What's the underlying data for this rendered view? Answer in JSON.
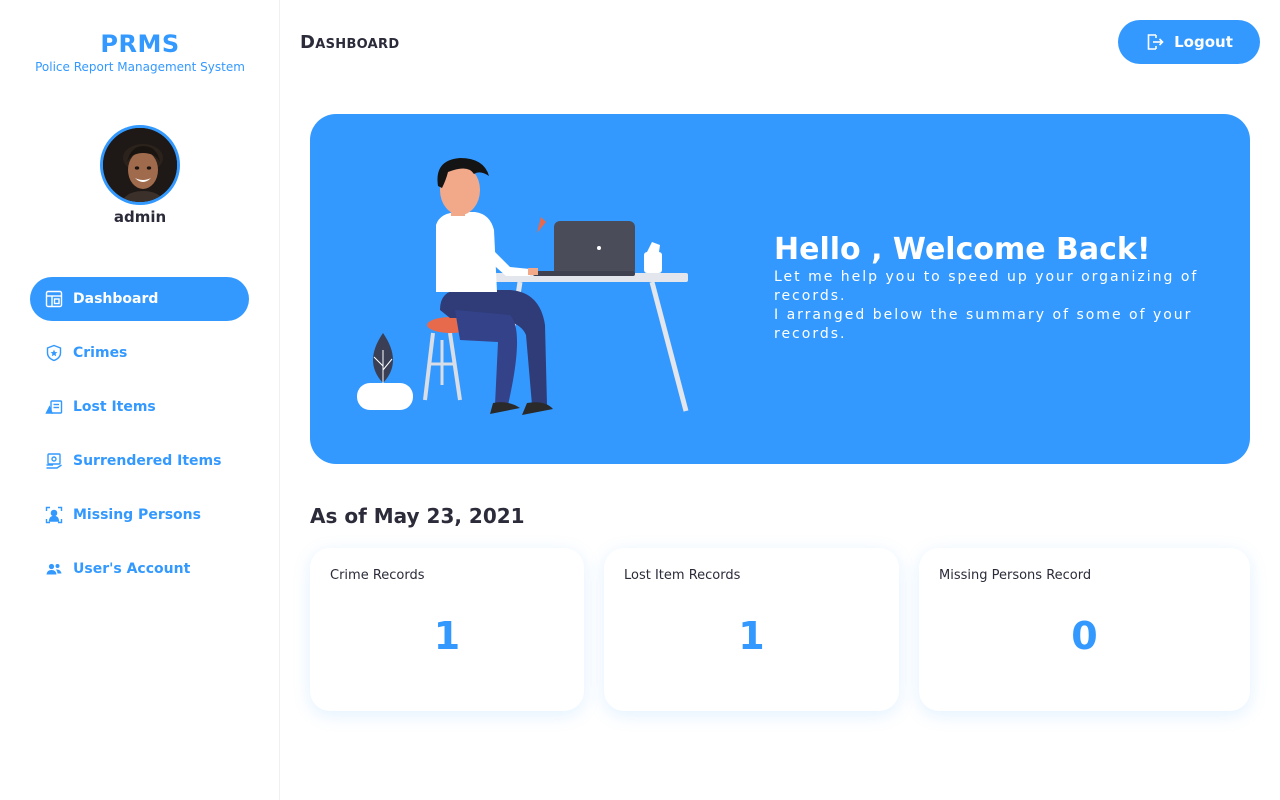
{
  "brand": {
    "title": "PRMS",
    "subtitle": "Police Report Management System"
  },
  "user": {
    "name": "admin"
  },
  "nav": {
    "items": [
      {
        "label": "Dashboard",
        "icon": "dashboard-icon",
        "active": true
      },
      {
        "label": "Crimes",
        "icon": "police-badge-icon",
        "active": false
      },
      {
        "label": "Lost Items",
        "icon": "lost-items-icon",
        "active": false
      },
      {
        "label": "Surrendered Items",
        "icon": "surrendered-items-icon",
        "active": false
      },
      {
        "label": "Missing Persons",
        "icon": "missing-person-icon",
        "active": false
      },
      {
        "label": "User's Account",
        "icon": "users-icon",
        "active": false
      }
    ]
  },
  "header": {
    "title": "Dashboard",
    "logout_label": "Logout"
  },
  "banner": {
    "heading": "Hello , Welcome Back!",
    "line1": "Let me help you to speed up your organizing of records.",
    "line2": "I arranged below the summary of some of your records."
  },
  "summary": {
    "as_of": "As of May 23, 2021",
    "cards": [
      {
        "label": "Crime Records",
        "value": "1"
      },
      {
        "label": "Lost Item Records",
        "value": "1"
      },
      {
        "label": "Missing Persons Record",
        "value": "0"
      }
    ]
  },
  "colors": {
    "accent": "#3399ff",
    "text": "#2b2b3a",
    "background": "#ffffff"
  }
}
